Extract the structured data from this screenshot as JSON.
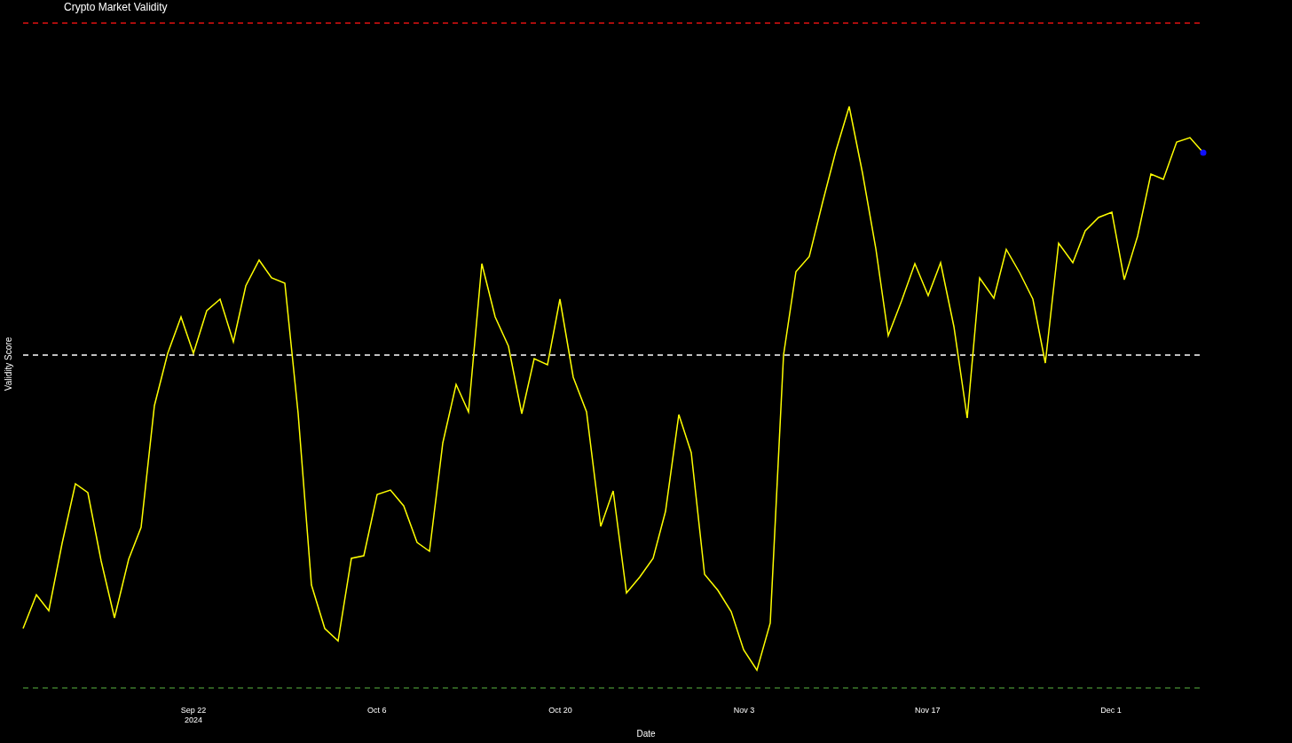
{
  "chart": {
    "title": "Crypto Market Validity",
    "ylabel": "Validity Score",
    "xlabel": "Date",
    "x_tick_labels": [
      {
        "label": "Sep 22",
        "sublabel": "2024"
      },
      {
        "label": "Oct 6"
      },
      {
        "label": "Oct 20"
      },
      {
        "label": "Nov 3"
      },
      {
        "label": "Nov 17"
      },
      {
        "label": "Dec 1"
      }
    ]
  }
}
